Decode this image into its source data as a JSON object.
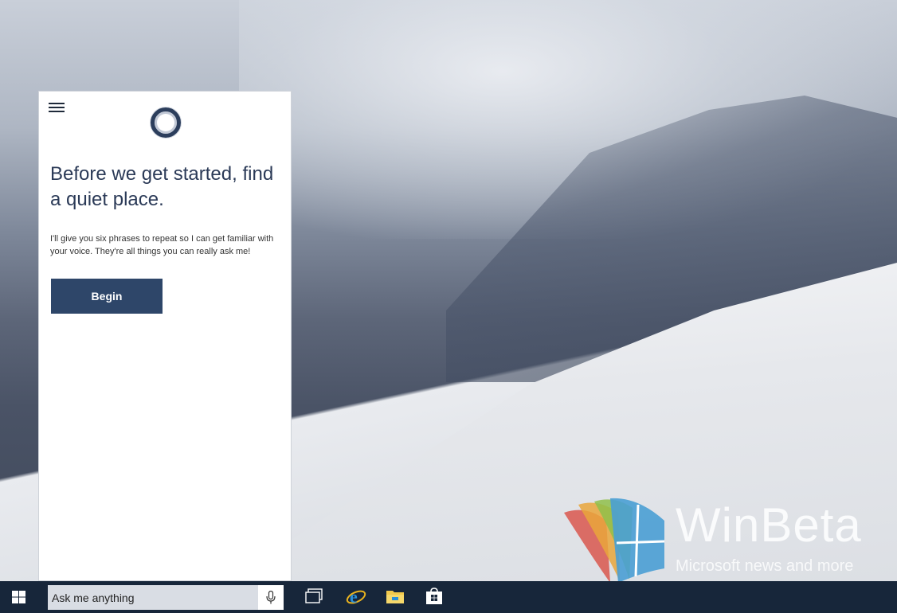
{
  "panel": {
    "heading": "Before we get started, find a quiet place.",
    "body": "I'll give you six phrases to repeat so I can get familiar with your voice.  They're all things you can really ask me!",
    "begin_label": "Begin"
  },
  "taskbar": {
    "search_placeholder": "Ask me anything",
    "icons": [
      "windows-start-icon",
      "microphone-icon",
      "task-view-icon",
      "internet-explorer-icon",
      "file-explorer-icon",
      "store-icon"
    ]
  },
  "watermark": {
    "title": "WinBeta",
    "subtitle": "Microsoft news and more"
  },
  "colors": {
    "accent": "#2e4669",
    "taskbar": "#17263a",
    "heading": "#2b3a57"
  }
}
